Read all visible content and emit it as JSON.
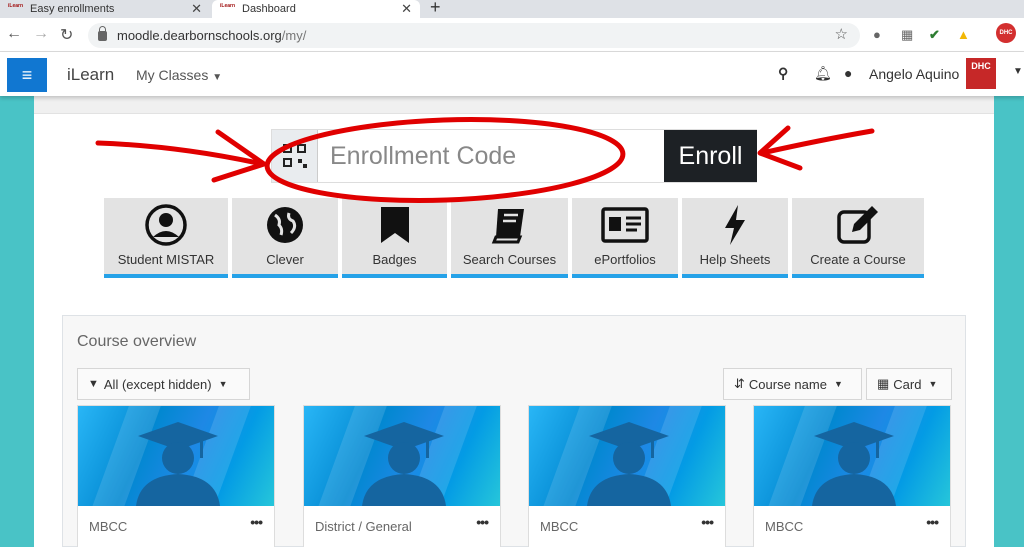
{
  "browser": {
    "tabs": [
      {
        "title": "Easy enrollments",
        "favicon": "iLearn"
      },
      {
        "title": "Dashboard",
        "favicon": "iLearn"
      }
    ],
    "url_host": "moodle.dearbornschools.org",
    "url_path": "/my/"
  },
  "navbar": {
    "brand": "iLearn",
    "my_classes": "My Classes",
    "user_name": "Angelo Aquino",
    "user_logo": "DHC"
  },
  "enroll": {
    "placeholder": "Enrollment Code",
    "button": "Enroll"
  },
  "tiles": [
    {
      "label": "Student MISTAR",
      "icon": "user-circle-icon"
    },
    {
      "label": "Clever",
      "icon": "globe-icon"
    },
    {
      "label": "Badges",
      "icon": "bookmark-icon"
    },
    {
      "label": "Search Courses",
      "icon": "book-icon"
    },
    {
      "label": "ePortfolios",
      "icon": "id-card-icon"
    },
    {
      "label": "Help Sheets",
      "icon": "bolt-icon"
    },
    {
      "label": "Create a Course",
      "icon": "edit-icon"
    }
  ],
  "overview": {
    "title": "Course overview",
    "filter": "All (except hidden)",
    "sort": "Course name",
    "view": "Card"
  },
  "courses": [
    {
      "category": "MBCC",
      "name": ""
    },
    {
      "category": "District / General",
      "name": ""
    },
    {
      "category": "MBCC",
      "name": ""
    },
    {
      "category": "MBCC",
      "name": ""
    }
  ],
  "colors": {
    "accent": "#1177d1",
    "tile_bar": "#26a2e8",
    "enroll_button": "#1d2125",
    "annotation": "#e00000"
  }
}
